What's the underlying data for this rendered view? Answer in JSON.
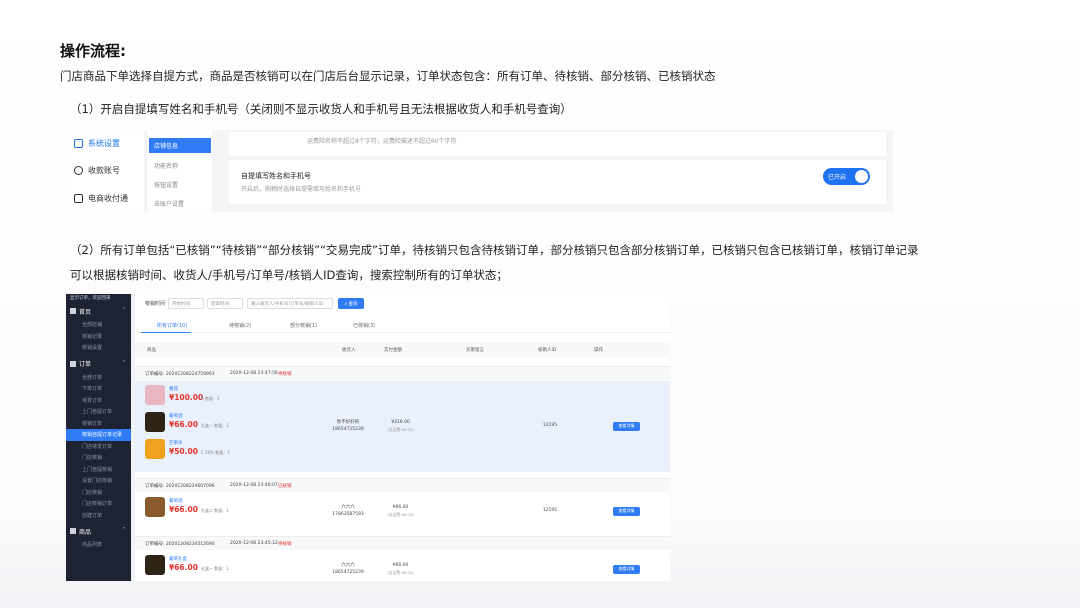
{
  "slide": {
    "title": "操作流程:",
    "intro": "门店商品下单选择自提方式，商品是否核销可以在门店后台显示记录，订单状态包含：所有订单、待核销、部分核销、已核销状态",
    "step1": "（1）开启自提填写姓名和手机号（关闭则不显示收货人和手机号且无法根据收货人和手机号查询）",
    "step2_line1": "（2）所有订单包括“已核销”“待核销”“部分核销”“交易完成”订单，待核销只包含待核销订单，部分核销只包含部分核销订单，已核销只包含已核销订单，核销订单记录",
    "step2_line2": "可以根据核销时间、收货人/手机号/订单号/核销人ID查询，搜索控制所有的订单状态；"
  },
  "shot1": {
    "menu": [
      "系统设置",
      "收款账号",
      "电商收付通"
    ],
    "submenu": [
      "店铺信息",
      "功能名称",
      "按钮设置",
      "去账户设置"
    ],
    "note": "运费险名称不超过8个字符，运费险描述不超过60个字符",
    "card_title": "自提填写姓名和手机号",
    "card_desc": "开启后，购物时选择自提需填写姓名和手机号",
    "toggle_label": "已开启",
    "accent": "#1f72f2"
  },
  "shot2": {
    "sidebar_top": "显示订单，欢迎回来",
    "groups": [
      {
        "label": "首页",
        "items": [
          "全部店铺",
          "核销记录",
          "核销设置"
        ]
      },
      {
        "label": "订单",
        "items": [
          "全部订单",
          "下单订单",
          "待发订单",
          "上门自提订单",
          "核销订单",
          "核销自提订单记录",
          "门店待发订单",
          "门店核销",
          "上门自提核销",
          "设置门店核销",
          "门店核销",
          "门店核销订单",
          "创建订单"
        ]
      },
      {
        "label": "商品",
        "items": [
          "商品列表"
        ]
      }
    ],
    "filter": {
      "label": "核销时间",
      "start_placeholder": "开始时间",
      "end_placeholder": "结束时间",
      "search_placeholder": "输入收货人/手机号/订单号/核销人ID",
      "query_button": "查询"
    },
    "tabs": [
      "所有订单(10)",
      "待核销(2)",
      "部分核销(1)",
      "已核销(3)"
    ],
    "columns": [
      "商品",
      "收货人",
      "实付金额",
      "买家留言",
      "核销人ID",
      "操作"
    ],
    "order_no_label": "订单编号:",
    "orders": [
      {
        "no": "20201208224759993",
        "time": "2020-12-08 23:47:56",
        "status": "待核销",
        "products": [
          {
            "name": "番茄",
            "price": "¥100.00",
            "spec": "A  数量：2"
          },
          {
            "name": "葡萄酒",
            "price": "¥66.00",
            "spec": "礼盒一  数量：1"
          },
          {
            "name": "芒果冰",
            "price": "¥50.00",
            "spec": "C 50%  数量：1"
          }
        ],
        "receiver": "你不好好的",
        "phone": "18654725239",
        "amount": "¥316.00",
        "amount_note": "(含运费 ¥0.00)",
        "verifier": "12195",
        "action": "查看详情"
      },
      {
        "no": "20201208224607096",
        "time": "2020-12-08 23:46:07",
        "status": "已核销",
        "products": [
          {
            "name": "葡萄酒",
            "price": "¥66.00",
            "spec": "礼盒二  数量：1"
          }
        ],
        "receiver": "六六六",
        "phone": "17863587593",
        "amount": "¥66.00",
        "amount_note": "(含运费 ¥0.00)",
        "verifier": "12195",
        "action": "查看详情"
      },
      {
        "no": "20201208234512690",
        "time": "2020-12-08 23:45:12",
        "status": "待核销",
        "products": [
          {
            "name": "葡萄礼盒",
            "price": "¥66.00",
            "spec": "礼盒一  数量：1"
          }
        ],
        "receiver": "六六六",
        "phone": "18654725239",
        "amount": "¥66.00",
        "amount_note": "(含运费 ¥0.00)",
        "verifier": "",
        "action": "查看详情"
      }
    ],
    "accent": "#2f7cf6",
    "price_color": "#e5322d"
  }
}
